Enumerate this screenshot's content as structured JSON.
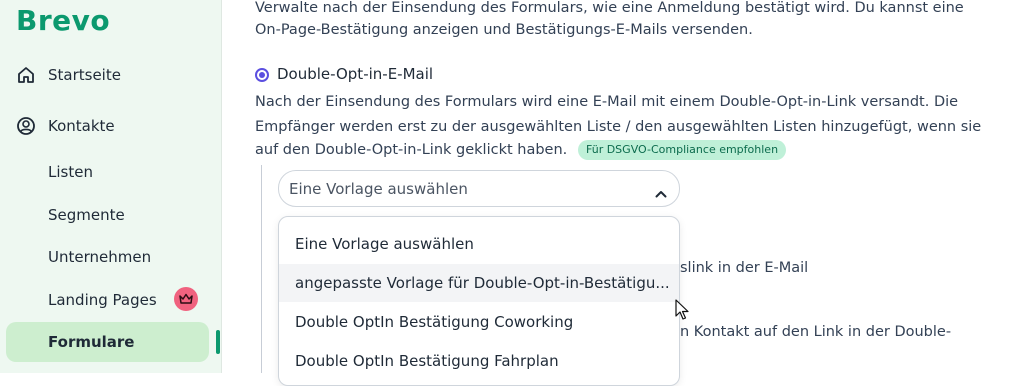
{
  "brand": {
    "name": "Brevo",
    "color": "#0b996e"
  },
  "sidebar": {
    "items": [
      {
        "label": "Startseite",
        "icon": "home-icon"
      },
      {
        "label": "Kontakte",
        "icon": "contacts-icon"
      }
    ],
    "subitems": [
      {
        "label": "Listen"
      },
      {
        "label": "Segmente"
      },
      {
        "label": "Unternehmen"
      },
      {
        "label": "Landing Pages",
        "badge_icon": "crown-icon"
      },
      {
        "label": "Formulare",
        "active": true
      }
    ]
  },
  "main": {
    "intro_line1": "Verwalte nach der Einsendung des Formulars, wie eine Anmeldung bestätigt wird. Du kannst eine",
    "intro_line2": "On-Page-Bestätigung anzeigen und Bestätigungs-E-Mails versenden.",
    "option_label": "Double-Opt-in-E-Mail",
    "desc_line1": "Nach der Einsendung des Formulars wird eine E-Mail mit einem Double-Opt-in-Link versandt. Die",
    "desc_line2": "Empfänger werden erst zu der ausgewählten Liste / den ausgewählten Listen hinzugefügt, wenn sie",
    "desc_line3": "auf den Double-Opt-in-Link geklickt haben.",
    "badge": "Für DSGVO-Compliance empfohlen",
    "select_value": "Eine Vorlage auswählen",
    "behind_text1": "slink in der E-Mail",
    "behind_text2": "n Kontakt auf den Link in der Double-",
    "dropdown_options": [
      "Eine Vorlage auswählen",
      "angepasste Vorlage für Double-Opt-in-Bestätigu...",
      "Double OptIn Bestätigung Coworking",
      "Double OptIn Bestätigung Fahrplan"
    ]
  }
}
